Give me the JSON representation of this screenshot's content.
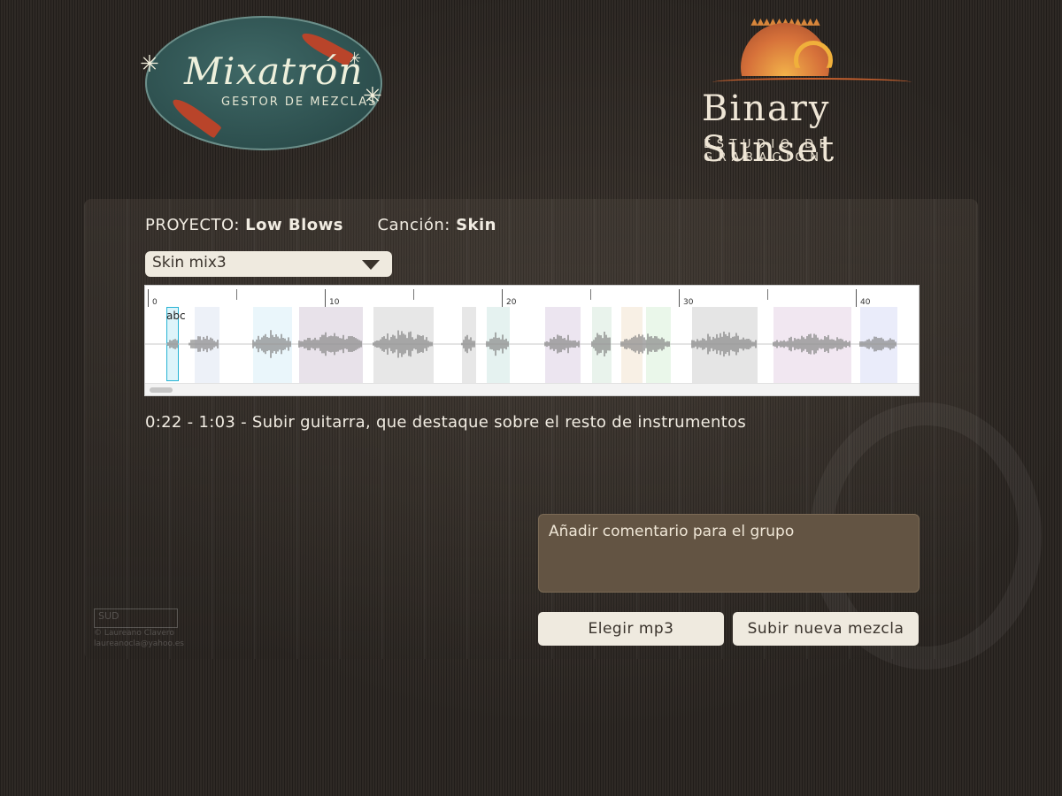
{
  "logos": {
    "left": {
      "title": "Mixatrón",
      "subtitle": "GESTOR DE MEZCLAS"
    },
    "right": {
      "title": "Binary Sunset",
      "subtitle": "ESTUDIO DE GRABACIÓN"
    }
  },
  "project": {
    "project_label": "PROYECTO:",
    "project_name": "Low Blows",
    "song_label": "Canción:",
    "song_name": "Skin"
  },
  "mix_select": {
    "selected": "Skin mix3"
  },
  "waveform": {
    "ruler_labels": [
      "0",
      "10",
      "20",
      "30",
      "40"
    ],
    "selected_region_label": "abc"
  },
  "comment_line": "0:22 - 1:03 - Subir guitarra, que destaque sobre el resto de instrumentos",
  "comment_input": {
    "placeholder": "Añadir comentario para el grupo",
    "value": ""
  },
  "buttons": {
    "choose_mp3": "Elegir mp3",
    "upload_mix": "Subir nueva mezcla"
  },
  "watermark": {
    "box": "SUD",
    "line1": "© Laureano Clavero",
    "line2": "laureanocla@yahoo.es"
  },
  "colors": {
    "accent_selection": "#27b3d4",
    "panel_bg": "#635443",
    "button_bg": "#efeadf"
  }
}
